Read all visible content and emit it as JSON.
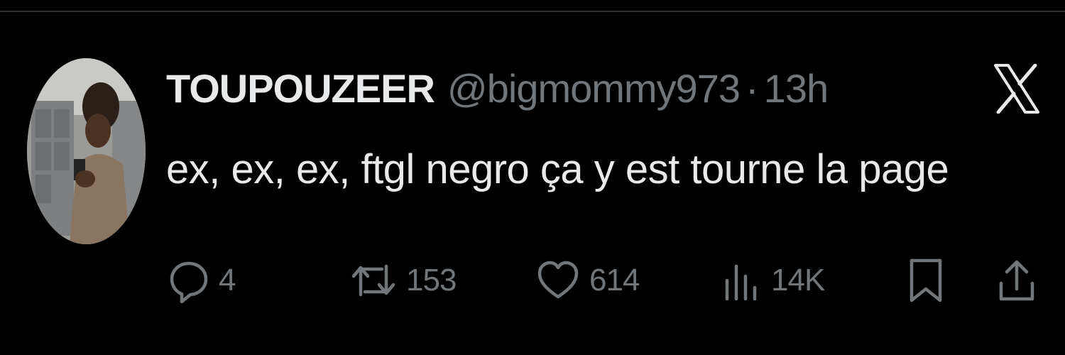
{
  "tweet": {
    "display_name": "TOUPOUZEER",
    "handle": "@bigmommy973",
    "separator": "·",
    "time": "13h",
    "text": "ex, ex, ex, ftgl negro ça y est tourne la page"
  },
  "actions": {
    "replies": "4",
    "reposts": "153",
    "likes": "614",
    "views": "14K"
  },
  "icons": {
    "brand": "x-logo-icon",
    "reply": "comment-bubble-icon",
    "repost": "repost-arrows-icon",
    "like": "heart-icon",
    "views": "bar-chart-icon",
    "bookmark": "bookmark-icon",
    "share": "share-upload-icon"
  },
  "colors": {
    "background": "#000000",
    "primary_text": "#e7e9ea",
    "secondary_text": "#71767b",
    "divider": "#2f3336"
  }
}
